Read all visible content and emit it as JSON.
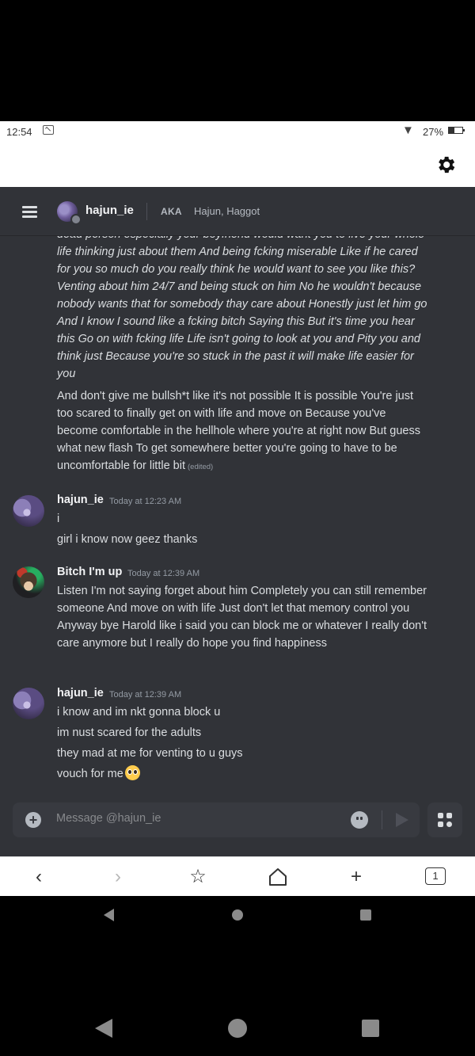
{
  "status_bar": {
    "time": "12:54",
    "battery": "27%"
  },
  "header": {
    "username": "hajun_ie",
    "aka_label": "AKA",
    "aka_names": "Hajun, Haggot"
  },
  "messages": {
    "cont1": "dead person especially your boyfriend would want you to live your whole life thinking just about them And being fcking miserable Like if he cared for you so much do you really think he would want to see you like this? Venting about him 24/7 and being stuck on him No he wouldn't because nobody wants that for somebody thay care about Honestly just let him go And I know I sound like a fcking bitch Saying this But it's time you hear this Go on with fcking life Life isn't going to look at you and Pity you and think just Because you're so stuck in the past it will make life easier for you",
    "cont2": "And don't give me bullsh*t like it's not possible It is possible You're just too scared to finally get on with life and move on Because you've become comfortable in the hellhole where you're at right now But guess what new flash To get somewhere  better you're going to have to be uncomfortable for little bit",
    "edited_label": "(edited)",
    "group1": {
      "author": "hajun_ie",
      "time": "Today at 12:23 AM",
      "lines": [
        "i",
        "girl i know now geez thanks"
      ]
    },
    "group2": {
      "author": "Bitch I'm up",
      "time": "Today at 12:39 AM",
      "text": "Listen I'm not saying forget about him Completely you can still remember someone And move on with life Just don't let that memory control you Anyway bye Harold like i said you can block me or whatever I really don't care anymore but I really do hope you find happiness"
    },
    "group3": {
      "author": "hajun_ie",
      "time": "Today at 12:39 AM",
      "lines": [
        "i know and im nkt gonna block u",
        "im nust scared for the adults",
        "they mad at me for venting to u guys",
        "vouch for me"
      ]
    }
  },
  "composer": {
    "placeholder": "Message @hajun_ie"
  },
  "browser_nav": {
    "tab_count": "1"
  },
  "icons": [
    "settings-gear-icon",
    "hamburger-menu-icon",
    "add-attachment-icon",
    "emoji-picker-icon",
    "send-icon",
    "apps-icon",
    "back-icon",
    "forward-icon",
    "bookmark-star-icon",
    "home-icon",
    "new-tab-icon",
    "tabs-icon"
  ],
  "colors": {
    "background": "#313338",
    "text": "#dbdee1",
    "muted": "#949ba4"
  }
}
